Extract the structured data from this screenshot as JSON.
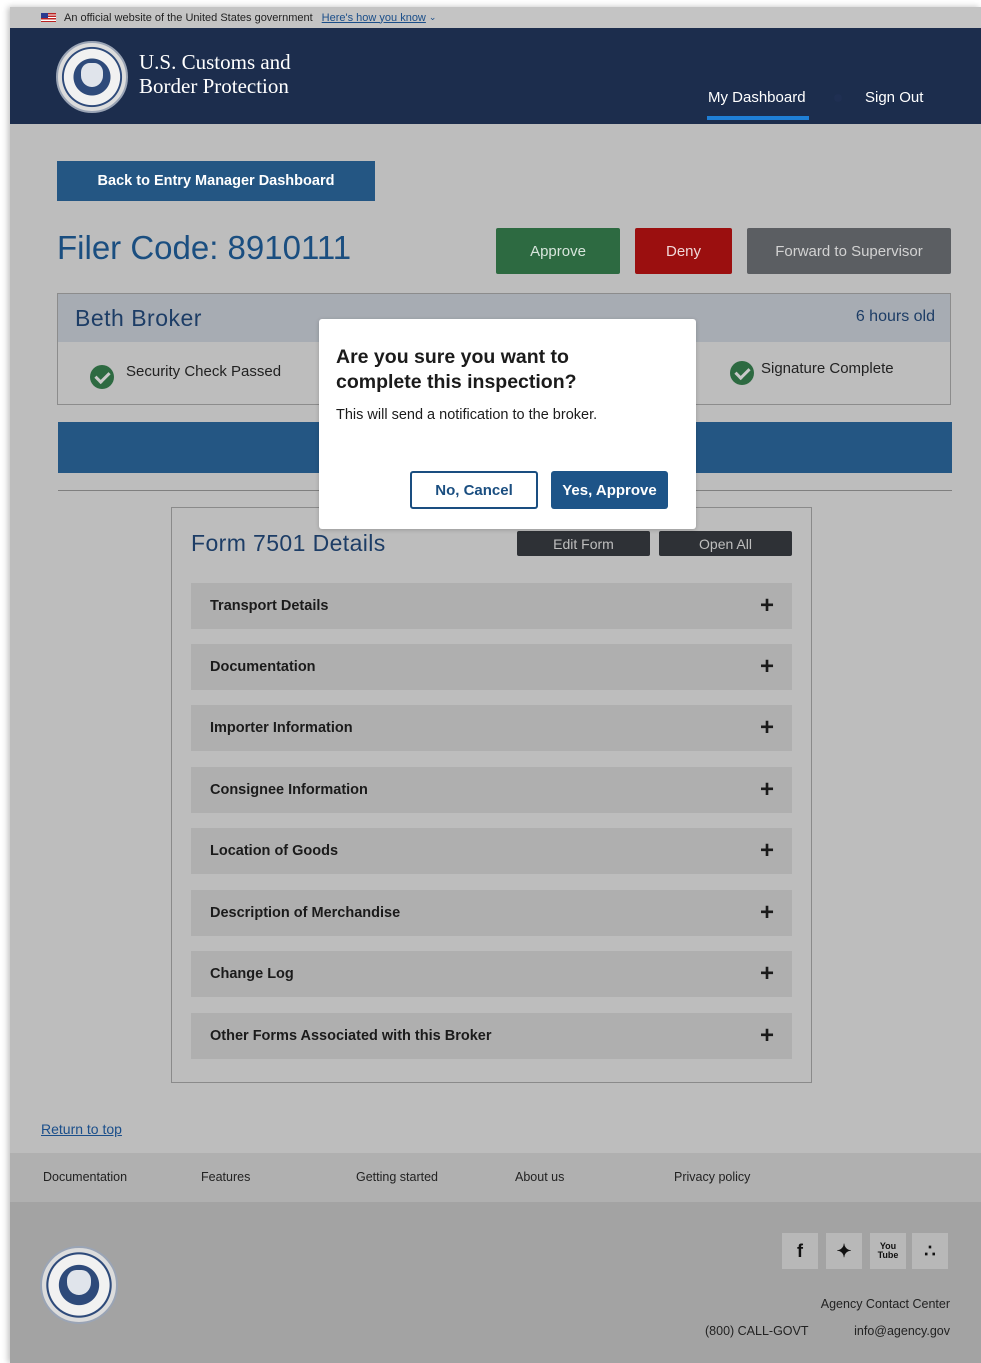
{
  "gov_banner": {
    "text": "An official website of the United States government",
    "link": "Here's how you know"
  },
  "header": {
    "agency_line1": "U.S. Customs and",
    "agency_line2": "Border Protection",
    "nav": {
      "dashboard": "My Dashboard",
      "sign_out": "Sign Out"
    }
  },
  "back_button": "Back to Entry Manager Dashboard",
  "filer": {
    "title": "Filer Code: 8910111"
  },
  "actions": {
    "approve": "Approve",
    "deny": "Deny",
    "forward": "Forward to Supervisor"
  },
  "broker": {
    "name": "Beth Broker",
    "age": "6 hours old",
    "security_check": "Security Check Passed",
    "signature": "Signature Complete"
  },
  "form": {
    "title": "Form 7501 Details",
    "edit": "Edit Form",
    "open_all": "Open All",
    "sections": [
      "Transport Details",
      "Documentation",
      "Importer Information",
      "Consignee Information",
      "Location of Goods",
      "Description of Merchandise",
      "Change Log",
      "Other Forms Associated with this Broker"
    ]
  },
  "modal": {
    "title": "Are you sure you want to complete this inspection?",
    "body": "This will send a notification to the broker.",
    "cancel": "No, Cancel",
    "confirm": "Yes, Approve"
  },
  "footer": {
    "return_top": "Return to top",
    "nav": [
      "Documentation",
      "Features",
      "Getting started",
      "About us",
      "Privacy policy"
    ],
    "social": [
      "facebook-icon",
      "twitter-icon",
      "youtube-icon",
      "rss-icon"
    ],
    "contact_title": "Agency Contact Center",
    "phone": "(800) CALL-GOVT",
    "email": "info@agency.gov"
  },
  "colors": {
    "header_bg": "#1c2d4d",
    "primary": "#245683",
    "approve": "#2d6a41",
    "deny": "#9b0f0f",
    "forward": "#5b5e62",
    "nav_underline": "#1f7fd6"
  }
}
